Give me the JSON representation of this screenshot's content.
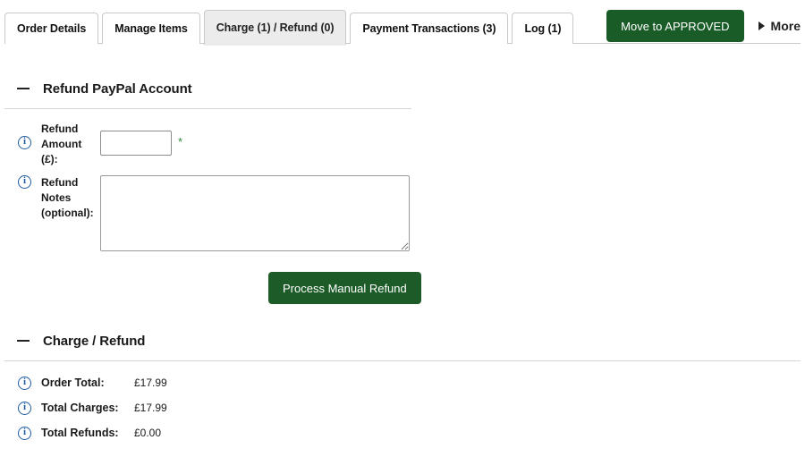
{
  "tabs": [
    {
      "label": "Order Details",
      "active": false
    },
    {
      "label": "Manage Items",
      "active": false
    },
    {
      "label": "Charge (1) / Refund (0)",
      "active": true
    },
    {
      "label": "Payment Transactions (3)",
      "active": false
    },
    {
      "label": "Log (1)",
      "active": false
    }
  ],
  "header": {
    "approve_button": "Move to APPROVED",
    "more_label": "More",
    "more_icon": "caret-right-icon",
    "approve_color": "#1a5c28"
  },
  "refund_section": {
    "title": "Refund PayPal Account",
    "collapse_icon": "minus-icon",
    "amount": {
      "info_icon": "info-circle-icon",
      "label": "Refund Amount (£):",
      "label_line1": "Refund",
      "label_line2": "Amount",
      "label_line3": "(£):",
      "value": "",
      "placeholder": "",
      "required_marker": "*",
      "required_color": "#2f8a3e"
    },
    "notes": {
      "info_icon": "info-circle-icon",
      "label": "Refund Notes (optional):",
      "label_line1": "Refund",
      "label_line2": "Notes",
      "label_line3": "(optional):",
      "value": "",
      "placeholder": ""
    },
    "submit_button": "Process Manual Refund"
  },
  "charge_refund_section": {
    "title": "Charge / Refund",
    "collapse_icon": "minus-icon",
    "rows": [
      {
        "info_icon": "info-circle-icon",
        "label": "Order Total:",
        "value": "£17.99"
      },
      {
        "info_icon": "info-circle-icon",
        "label": "Total Charges:",
        "value": "£17.99"
      },
      {
        "info_icon": "info-circle-icon",
        "label": "Total Refunds:",
        "value": "£0.00"
      }
    ]
  }
}
